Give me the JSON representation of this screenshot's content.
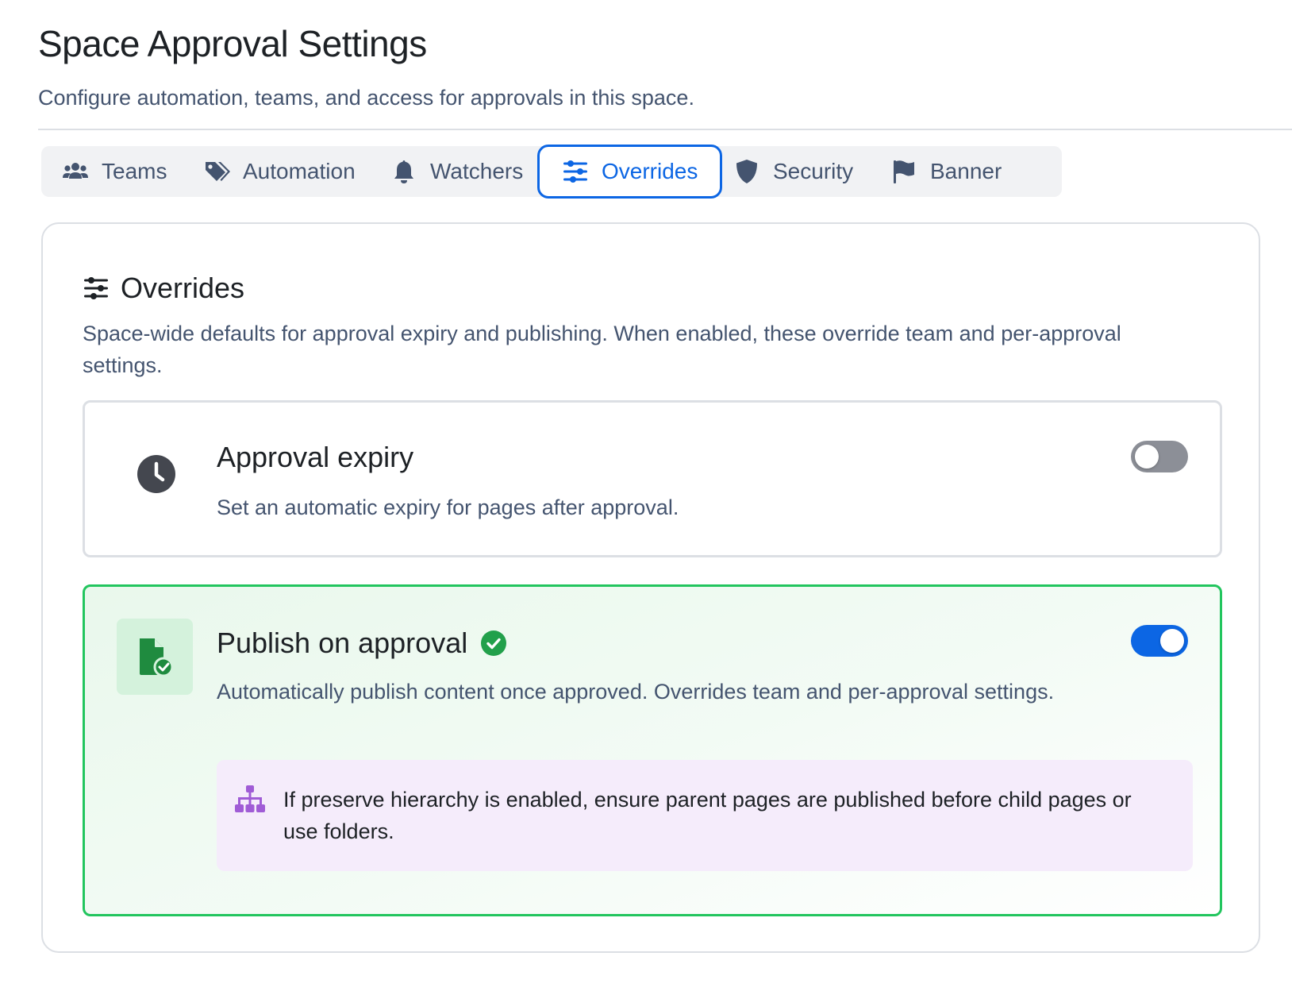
{
  "header": {
    "title": "Space Approval Settings",
    "subtitle": "Configure automation, teams, and access for approvals in this space."
  },
  "tabs": [
    {
      "label": "Teams",
      "icon": "people-icon",
      "active": false
    },
    {
      "label": "Automation",
      "icon": "tags-icon",
      "active": false
    },
    {
      "label": "Watchers",
      "icon": "bell-icon",
      "active": false
    },
    {
      "label": "Overrides",
      "icon": "sliders-icon",
      "active": true
    },
    {
      "label": "Security",
      "icon": "shield-icon",
      "active": false
    },
    {
      "label": "Banner",
      "icon": "flag-icon",
      "active": false
    }
  ],
  "panel": {
    "title": "Overrides",
    "icon": "sliders-icon",
    "description": "Space-wide defaults for approval expiry and publishing. When enabled, these override team and per-approval settings."
  },
  "settings": {
    "expiry": {
      "title": "Approval expiry",
      "description": "Set an automatic expiry for pages after approval.",
      "icon": "clock-icon",
      "enabled": false
    },
    "publish": {
      "title": "Publish on approval",
      "description": "Automatically publish content once approved. Overrides team and per-approval settings.",
      "icon": "file-check-icon",
      "badge_icon": "check-circle-icon",
      "enabled": true,
      "note": "If preserve hierarchy is enabled, ensure parent pages are published before child pages or use folders.",
      "note_icon": "sitemap-icon"
    }
  },
  "colors": {
    "accent": "#0c66e4",
    "success": "#22a04b",
    "note_bg": "#f5ecfb",
    "note_icon": "#a05cd6"
  }
}
